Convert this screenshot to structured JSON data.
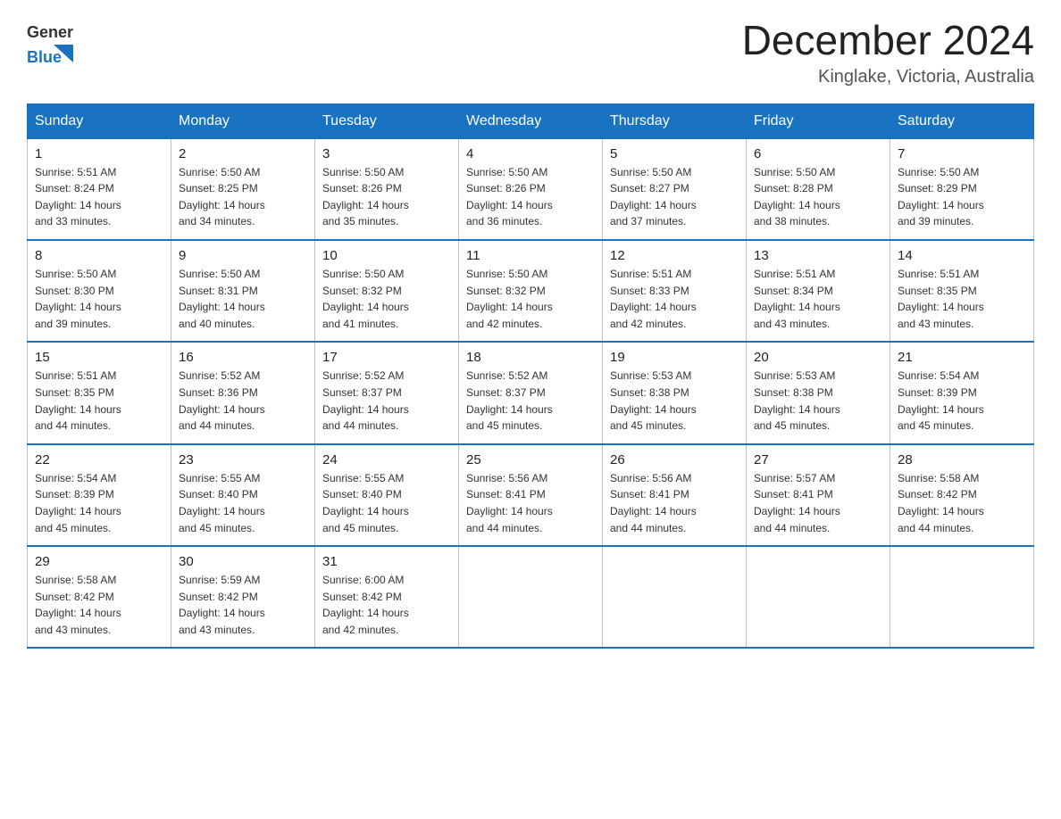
{
  "header": {
    "logo_general": "General",
    "logo_blue": "Blue",
    "month_year": "December 2024",
    "location": "Kinglake, Victoria, Australia"
  },
  "days_of_week": [
    "Sunday",
    "Monday",
    "Tuesday",
    "Wednesday",
    "Thursday",
    "Friday",
    "Saturday"
  ],
  "weeks": [
    [
      {
        "day": "1",
        "sunrise": "5:51 AM",
        "sunset": "8:24 PM",
        "daylight": "14 hours and 33 minutes."
      },
      {
        "day": "2",
        "sunrise": "5:50 AM",
        "sunset": "8:25 PM",
        "daylight": "14 hours and 34 minutes."
      },
      {
        "day": "3",
        "sunrise": "5:50 AM",
        "sunset": "8:26 PM",
        "daylight": "14 hours and 35 minutes."
      },
      {
        "day": "4",
        "sunrise": "5:50 AM",
        "sunset": "8:26 PM",
        "daylight": "14 hours and 36 minutes."
      },
      {
        "day": "5",
        "sunrise": "5:50 AM",
        "sunset": "8:27 PM",
        "daylight": "14 hours and 37 minutes."
      },
      {
        "day": "6",
        "sunrise": "5:50 AM",
        "sunset": "8:28 PM",
        "daylight": "14 hours and 38 minutes."
      },
      {
        "day": "7",
        "sunrise": "5:50 AM",
        "sunset": "8:29 PM",
        "daylight": "14 hours and 39 minutes."
      }
    ],
    [
      {
        "day": "8",
        "sunrise": "5:50 AM",
        "sunset": "8:30 PM",
        "daylight": "14 hours and 39 minutes."
      },
      {
        "day": "9",
        "sunrise": "5:50 AM",
        "sunset": "8:31 PM",
        "daylight": "14 hours and 40 minutes."
      },
      {
        "day": "10",
        "sunrise": "5:50 AM",
        "sunset": "8:32 PM",
        "daylight": "14 hours and 41 minutes."
      },
      {
        "day": "11",
        "sunrise": "5:50 AM",
        "sunset": "8:32 PM",
        "daylight": "14 hours and 42 minutes."
      },
      {
        "day": "12",
        "sunrise": "5:51 AM",
        "sunset": "8:33 PM",
        "daylight": "14 hours and 42 minutes."
      },
      {
        "day": "13",
        "sunrise": "5:51 AM",
        "sunset": "8:34 PM",
        "daylight": "14 hours and 43 minutes."
      },
      {
        "day": "14",
        "sunrise": "5:51 AM",
        "sunset": "8:35 PM",
        "daylight": "14 hours and 43 minutes."
      }
    ],
    [
      {
        "day": "15",
        "sunrise": "5:51 AM",
        "sunset": "8:35 PM",
        "daylight": "14 hours and 44 minutes."
      },
      {
        "day": "16",
        "sunrise": "5:52 AM",
        "sunset": "8:36 PM",
        "daylight": "14 hours and 44 minutes."
      },
      {
        "day": "17",
        "sunrise": "5:52 AM",
        "sunset": "8:37 PM",
        "daylight": "14 hours and 44 minutes."
      },
      {
        "day": "18",
        "sunrise": "5:52 AM",
        "sunset": "8:37 PM",
        "daylight": "14 hours and 45 minutes."
      },
      {
        "day": "19",
        "sunrise": "5:53 AM",
        "sunset": "8:38 PM",
        "daylight": "14 hours and 45 minutes."
      },
      {
        "day": "20",
        "sunrise": "5:53 AM",
        "sunset": "8:38 PM",
        "daylight": "14 hours and 45 minutes."
      },
      {
        "day": "21",
        "sunrise": "5:54 AM",
        "sunset": "8:39 PM",
        "daylight": "14 hours and 45 minutes."
      }
    ],
    [
      {
        "day": "22",
        "sunrise": "5:54 AM",
        "sunset": "8:39 PM",
        "daylight": "14 hours and 45 minutes."
      },
      {
        "day": "23",
        "sunrise": "5:55 AM",
        "sunset": "8:40 PM",
        "daylight": "14 hours and 45 minutes."
      },
      {
        "day": "24",
        "sunrise": "5:55 AM",
        "sunset": "8:40 PM",
        "daylight": "14 hours and 45 minutes."
      },
      {
        "day": "25",
        "sunrise": "5:56 AM",
        "sunset": "8:41 PM",
        "daylight": "14 hours and 44 minutes."
      },
      {
        "day": "26",
        "sunrise": "5:56 AM",
        "sunset": "8:41 PM",
        "daylight": "14 hours and 44 minutes."
      },
      {
        "day": "27",
        "sunrise": "5:57 AM",
        "sunset": "8:41 PM",
        "daylight": "14 hours and 44 minutes."
      },
      {
        "day": "28",
        "sunrise": "5:58 AM",
        "sunset": "8:42 PM",
        "daylight": "14 hours and 44 minutes."
      }
    ],
    [
      {
        "day": "29",
        "sunrise": "5:58 AM",
        "sunset": "8:42 PM",
        "daylight": "14 hours and 43 minutes."
      },
      {
        "day": "30",
        "sunrise": "5:59 AM",
        "sunset": "8:42 PM",
        "daylight": "14 hours and 43 minutes."
      },
      {
        "day": "31",
        "sunrise": "6:00 AM",
        "sunset": "8:42 PM",
        "daylight": "14 hours and 42 minutes."
      },
      null,
      null,
      null,
      null
    ]
  ],
  "labels": {
    "sunrise": "Sunrise:",
    "sunset": "Sunset:",
    "daylight": "Daylight:"
  }
}
